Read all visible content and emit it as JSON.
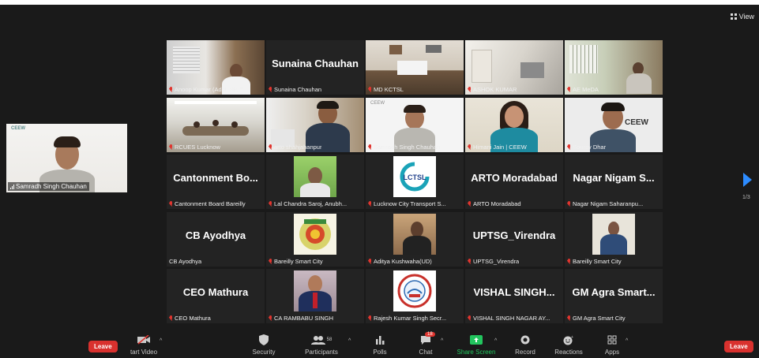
{
  "view_label": "View",
  "self_view": {
    "name": "Samradh Singh Chauhan",
    "logo": "CEEW"
  },
  "tiles": [
    {
      "label": "Anoop Kumar (Addl. SP, T...",
      "kind": "photo",
      "scene": "office-window"
    },
    {
      "label": "Sunaina Chauhan",
      "kind": "name",
      "big": "Sunaina Chauhan"
    },
    {
      "label": "MD KCTSL",
      "kind": "photo",
      "scene": "office-desk"
    },
    {
      "label": "ASHOK KUMAR",
      "kind": "photo",
      "scene": "office-bright"
    },
    {
      "label": "AE MeDA",
      "kind": "photo",
      "scene": "office-window2"
    },
    {
      "label": "RCUES Lucknow",
      "kind": "photo",
      "scene": "meeting-room",
      "active": true
    },
    {
      "label": "arto shahjahanpur",
      "kind": "photo",
      "scene": "man-desk"
    },
    {
      "label": "Samradh Singh Chauhan",
      "kind": "photo",
      "scene": "man-white"
    },
    {
      "label": "Himani Jain | CEEW",
      "kind": "photo",
      "scene": "woman"
    },
    {
      "label": "Sourav Dhar",
      "kind": "photo",
      "scene": "man-ceew",
      "logo": "CEEW"
    },
    {
      "label": "Cantonment Board Bareilly",
      "kind": "name",
      "big": "Cantonment Bo..."
    },
    {
      "label": "Lal Chandra Saroj, Anubh...",
      "kind": "thumb",
      "scene": "man-thumb"
    },
    {
      "label": "Lucknow City Transport S...",
      "kind": "thumb",
      "scene": "lctsl",
      "logo": "LCTSL"
    },
    {
      "label": "ARTO Moradabad",
      "kind": "name",
      "big": "ARTO Moradabad"
    },
    {
      "label": "Nagar Nigam Saharanpu...",
      "kind": "name",
      "big": "Nagar Nigam S..."
    },
    {
      "label": "CB Ayodhya",
      "kind": "name",
      "big": "CB Ayodhya",
      "unmuted": true
    },
    {
      "label": "Bareilly Smart City",
      "kind": "thumb",
      "scene": "emblem"
    },
    {
      "label": "Aditya Kushwaha(UD)",
      "kind": "thumb",
      "scene": "man-sit"
    },
    {
      "label": "UPTSG_Virendra",
      "kind": "name",
      "big": "UPTSG_Virendra"
    },
    {
      "label": "Bareilly Smart City",
      "kind": "thumb",
      "scene": "man-grey"
    },
    {
      "label": "CEO Mathura",
      "kind": "name",
      "big": "CEO Mathura"
    },
    {
      "label": "CA RAMBABU SINGH",
      "kind": "thumb",
      "scene": "man-red"
    },
    {
      "label": "Rajesh Kumar Singh Secr...",
      "kind": "thumb",
      "scene": "seal"
    },
    {
      "label": "VISHAL SINGH NAGAR AY...",
      "kind": "name",
      "big": "VISHAL SINGH..."
    },
    {
      "label": "GM Agra Smart City",
      "kind": "name",
      "big": "GM Agra Smart..."
    }
  ],
  "page_indicator": "1/3",
  "toolbar": {
    "leave": "Leave",
    "start_video": "tart Video",
    "security": "Security",
    "participants": "Participants",
    "participants_count": "58",
    "polls": "Polls",
    "chat": "Chat",
    "chat_badge": "18",
    "share_screen": "Share Screen",
    "record": "Record",
    "reactions": "Reactions",
    "apps": "Apps"
  },
  "colors": {
    "accent_blue": "#2d8cff",
    "leave_red": "#d9312e",
    "active_green": "#7ed321",
    "share_green": "#22c55e"
  }
}
